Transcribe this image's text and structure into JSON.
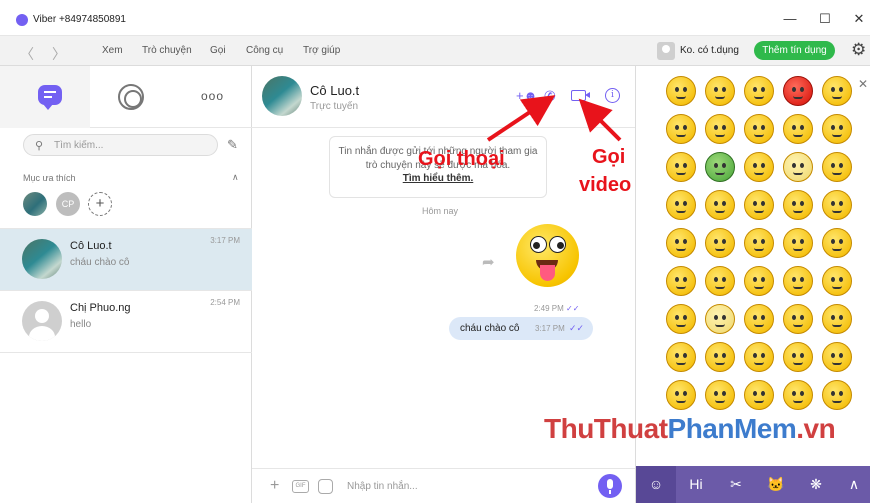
{
  "titlebar": {
    "title": "Viber +84974850891",
    "minimize": "—",
    "maximize": "☐",
    "close": "✕"
  },
  "menubar": {
    "back": "〈",
    "forward": "〉",
    "menus": [
      "Xem",
      "Trò chuyện",
      "Gọi",
      "Công cụ",
      "Trợ giúp"
    ],
    "user": "Ko. có t.dụng",
    "credit_button": "Thêm tín dụng"
  },
  "sidebar": {
    "more_tab": "ooo",
    "search_placeholder": "Tìm kiếm...",
    "favorites_label": "Mục ưa thích",
    "favorites": [
      {
        "initials": ""
      },
      {
        "initials": "CP"
      },
      {
        "initials": "+"
      }
    ],
    "conversations": [
      {
        "name": "Cô Luo.t",
        "message": "cháu chào cô",
        "time": "3:17 PM"
      },
      {
        "name": "Chị Phuo.ng",
        "message": "hello",
        "time": "2:54 PM"
      }
    ]
  },
  "chat": {
    "contact_name": "Cô Luo.t",
    "status": "Trực tuyến",
    "notice_text": "Tin nhắn được gửi tới những người tham gia trò chuyện này sẽ được mã hóa.",
    "notice_link": "Tìm hiểu thêm.",
    "date_separator": "Hôm nay",
    "sticker_time": "2:49 PM",
    "message_text": "cháu chào cô",
    "message_time": "3:17 PM",
    "input_placeholder": "Nhập tin nhắn...",
    "gif_label": "GIF"
  },
  "emoji_panel": {
    "tabs": [
      "☺",
      "Hi",
      "✂",
      "🐱",
      "❋",
      "∧"
    ]
  },
  "annotations": {
    "call_label": "Gọi thoại",
    "video_label_1": "Gọi",
    "video_label_2": "video"
  },
  "watermark": {
    "part1": "ThuThuat",
    "part2": "PhanMem",
    "part3": ".vn"
  },
  "colors": {
    "viber_purple": "#7360f2",
    "credit_green": "#2fb94b",
    "annotation_red": "#e8131b",
    "selected_row": "#dce9f0"
  }
}
